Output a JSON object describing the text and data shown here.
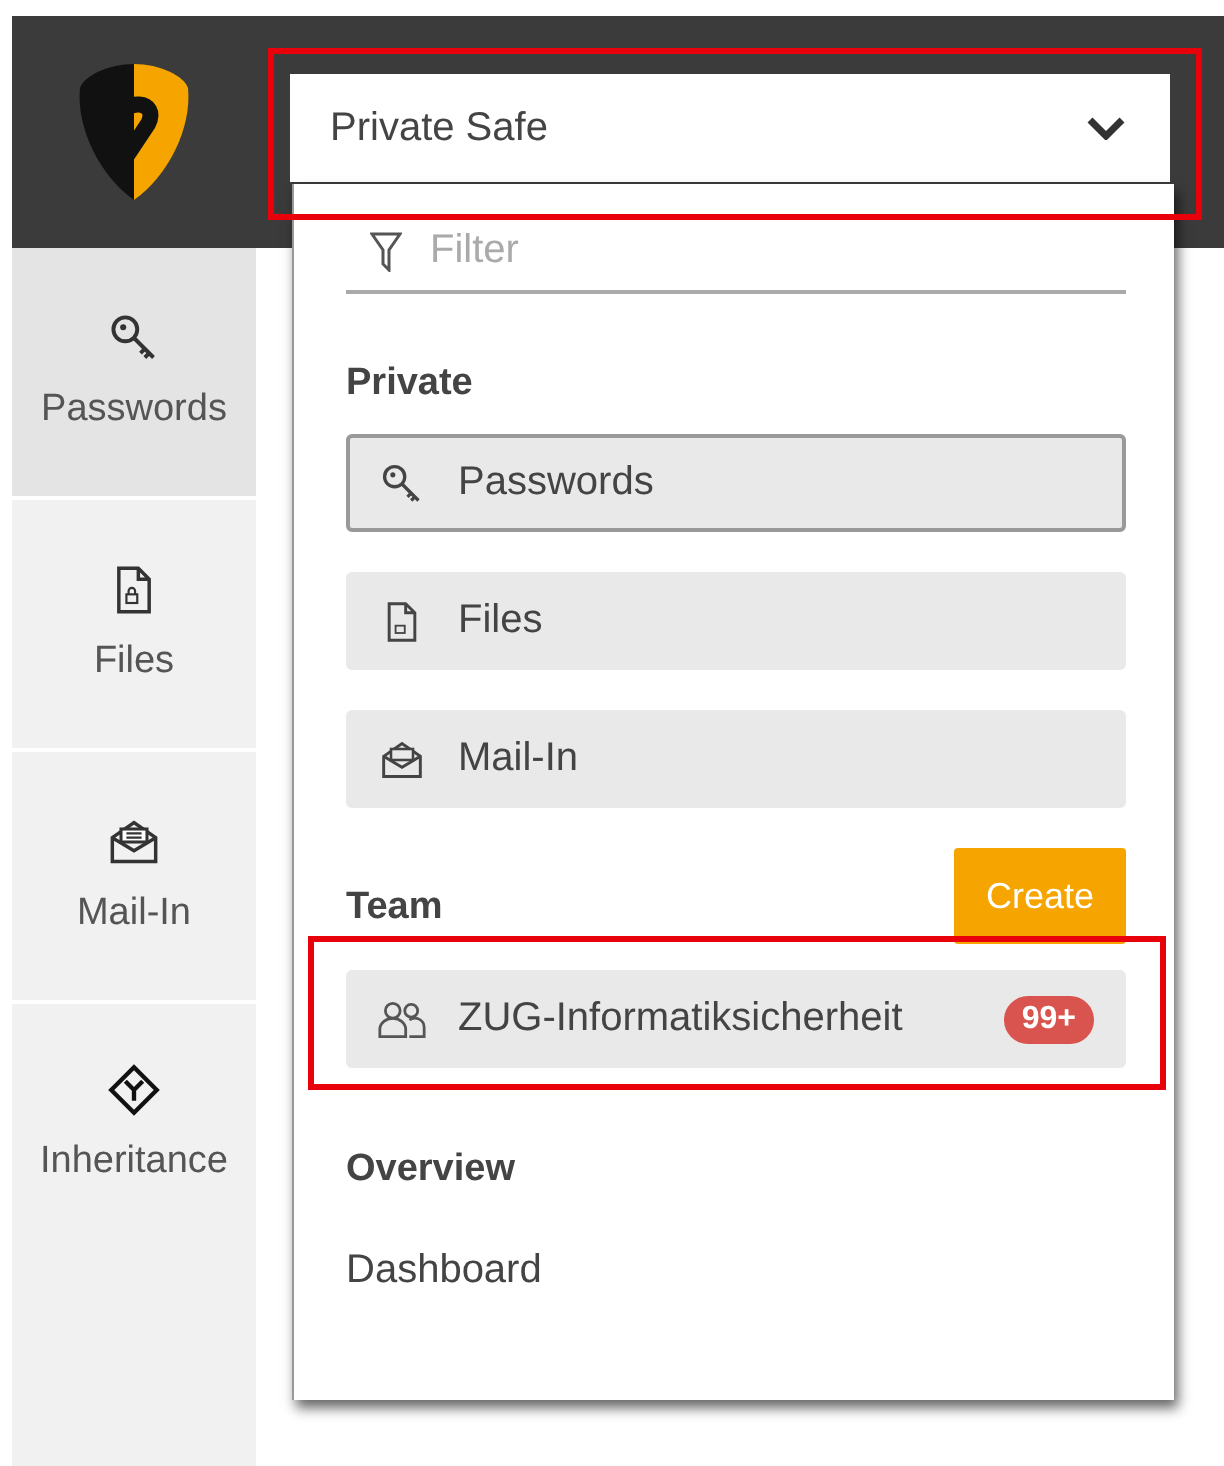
{
  "safe_selector": {
    "value": "Private Safe",
    "highlighted": true
  },
  "sidebar": {
    "items": [
      {
        "kind": "key",
        "label": "Passwords",
        "selected": true
      },
      {
        "kind": "file",
        "label": "Files",
        "selected": false
      },
      {
        "kind": "mail",
        "label": "Mail-In",
        "selected": false
      },
      {
        "kind": "inherit",
        "label": "Inheritance",
        "selected": false
      }
    ]
  },
  "dropdown": {
    "filter": {
      "placeholder": "Filter"
    },
    "private": {
      "heading": "Private",
      "items": [
        {
          "kind": "key",
          "label": "Passwords",
          "selected": true
        },
        {
          "kind": "file",
          "label": "Files",
          "selected": false
        },
        {
          "kind": "mail",
          "label": "Mail-In",
          "selected": false
        }
      ]
    },
    "team": {
      "heading": "Team",
      "create_button": "Create",
      "items": [
        {
          "label": "ZUG-Informatiksicherheit",
          "badge": "99+",
          "highlighted": true
        }
      ]
    },
    "overview": {
      "heading": "Overview",
      "items": [
        "Dashboard"
      ]
    }
  }
}
